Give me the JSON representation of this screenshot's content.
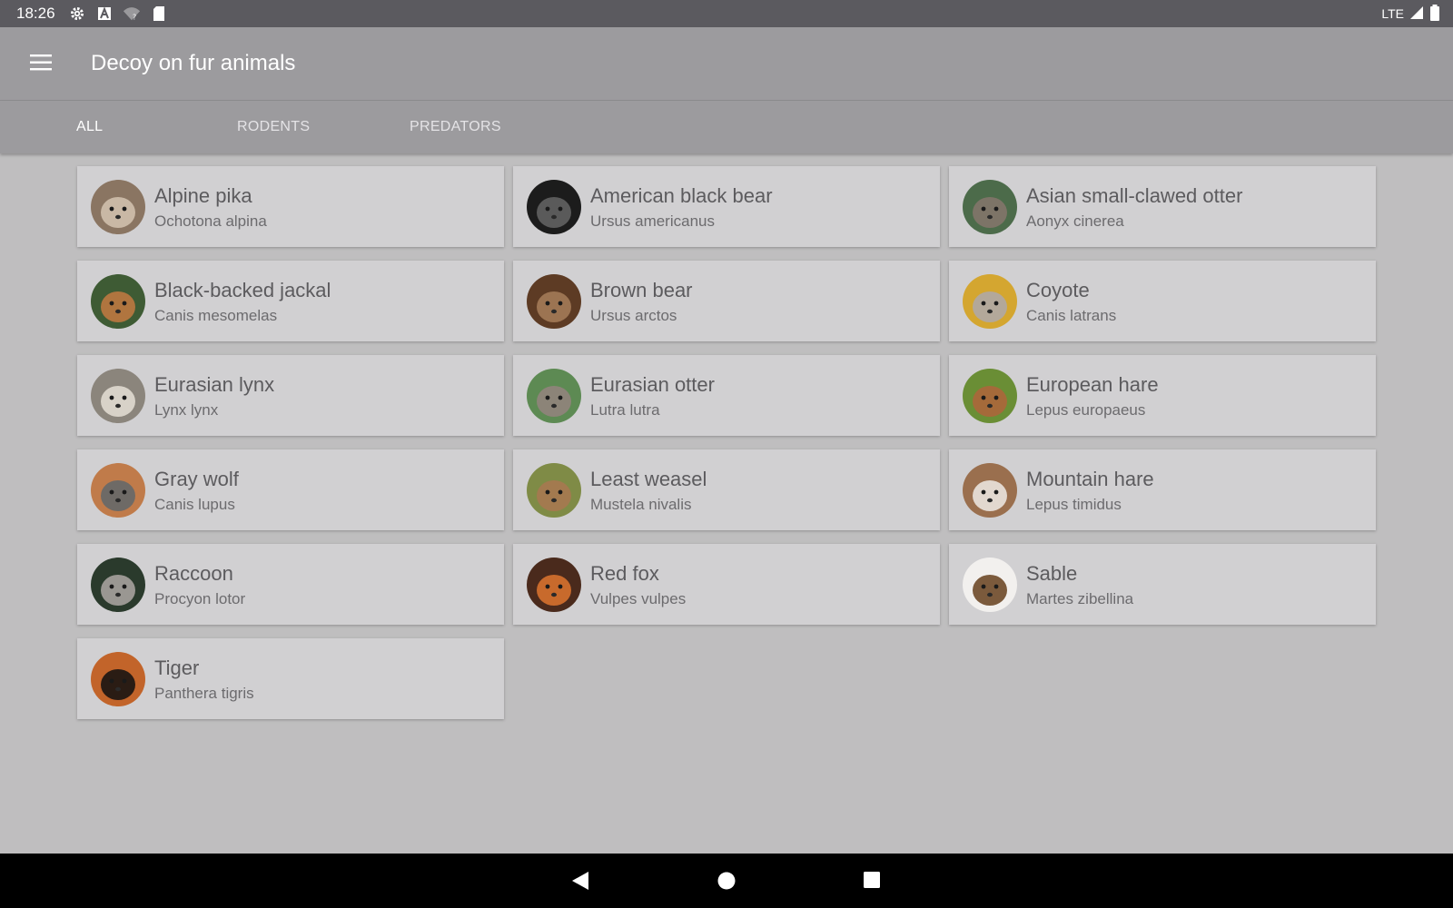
{
  "status_bar": {
    "time": "18:26",
    "network": "LTE",
    "icons": [
      "settings-gear-icon",
      "a-letter-icon",
      "wifi-question-icon",
      "sd-card-icon",
      "signal-icon",
      "battery-icon"
    ]
  },
  "app_bar": {
    "title": "Decoy on fur animals",
    "menu_icon": "hamburger-menu-icon"
  },
  "tabs": [
    {
      "label": "ALL",
      "active": true
    },
    {
      "label": "RODENTS",
      "active": false
    },
    {
      "label": "PREDATORS",
      "active": false
    }
  ],
  "animals": [
    {
      "name": "Alpine pika",
      "scientific": "Ochotona alpina",
      "c1": "#8a7562",
      "c2": "#c9b8a5"
    },
    {
      "name": "American black bear",
      "scientific": "Ursus americanus",
      "c1": "#1c1c1c",
      "c2": "#5a5a5a"
    },
    {
      "name": "Asian small-clawed otter",
      "scientific": "Aonyx cinerea",
      "c1": "#4c6b4a",
      "c2": "#7d7467"
    },
    {
      "name": "Black-backed jackal",
      "scientific": "Canis mesomelas",
      "c1": "#3e5b34",
      "c2": "#b0753f"
    },
    {
      "name": "Brown bear",
      "scientific": "Ursus arctos",
      "c1": "#5d3b24",
      "c2": "#9c7452"
    },
    {
      "name": "Coyote",
      "scientific": "Canis latrans",
      "c1": "#d4a630",
      "c2": "#b3a89a"
    },
    {
      "name": "Eurasian lynx",
      "scientific": "Lynx lynx",
      "c1": "#8b857c",
      "c2": "#d8d2c8"
    },
    {
      "name": "Eurasian otter",
      "scientific": "Lutra lutra",
      "c1": "#5d8a53",
      "c2": "#8c8478"
    },
    {
      "name": "European hare",
      "scientific": "Lepus europaeus",
      "c1": "#6a8e35",
      "c2": "#a56a3a"
    },
    {
      "name": "Gray wolf",
      "scientific": "Canis lupus",
      "c1": "#c07b4a",
      "c2": "#6e6a66"
    },
    {
      "name": "Least weasel",
      "scientific": "Mustela nivalis",
      "c1": "#7f8b46",
      "c2": "#a37a4f"
    },
    {
      "name": "Mountain hare",
      "scientific": "Lepus timidus",
      "c1": "#9a6f4e",
      "c2": "#e2d8cf"
    },
    {
      "name": "Raccoon",
      "scientific": "Procyon lotor",
      "c1": "#2a3a2c",
      "c2": "#9a9792"
    },
    {
      "name": "Red fox",
      "scientific": "Vulpes vulpes",
      "c1": "#4a2a1c",
      "c2": "#c86a2c"
    },
    {
      "name": "Sable",
      "scientific": "Martes zibellina",
      "c1": "#f2f0ee",
      "c2": "#7b5a3c"
    },
    {
      "name": "Tiger",
      "scientific": "Panthera tigris",
      "c1": "#c2642a",
      "c2": "#2a1c14"
    }
  ],
  "nav_bar": {
    "icons": [
      "back-triangle-icon",
      "home-circle-icon",
      "recents-square-icon"
    ]
  },
  "colors": {
    "background": "#bfbebf",
    "app_bar": "#9c9b9e",
    "status_bar": "#5b5a5f",
    "card": "#d1d0d2",
    "primary_text": "#5c5b5e"
  }
}
